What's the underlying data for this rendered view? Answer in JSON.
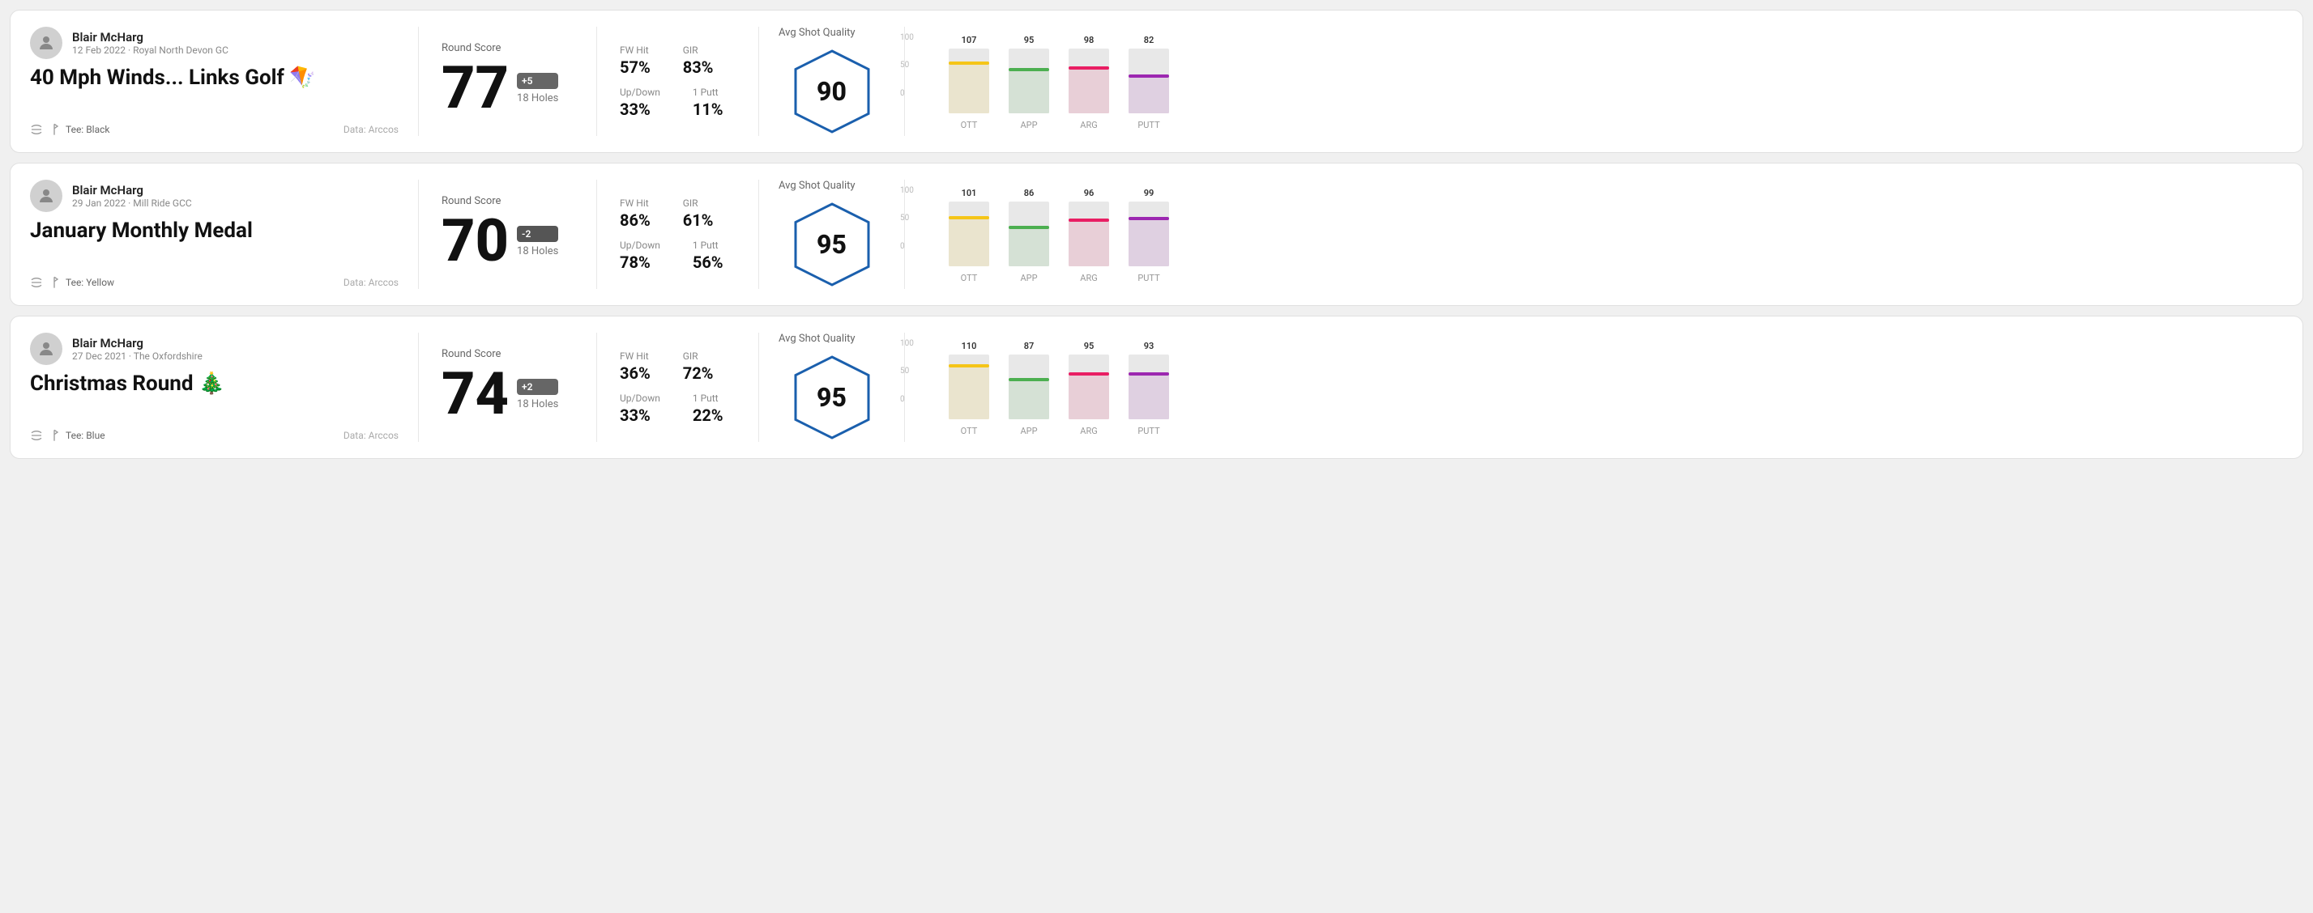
{
  "rounds": [
    {
      "id": "round-1",
      "player": {
        "name": "Blair McHarg",
        "date": "12 Feb 2022",
        "course": "Royal North Devon GC"
      },
      "title": "40 Mph Winds... Links Golf 🪁",
      "tee": "Black",
      "data_source": "Data: Arccos",
      "round_score_label": "Round Score",
      "score": "77",
      "score_diff": "+5",
      "holes": "18 Holes",
      "fw_hit_label": "FW Hit",
      "fw_hit": "57%",
      "gir_label": "GIR",
      "gir": "83%",
      "updown_label": "Up/Down",
      "updown": "33%",
      "oneputt_label": "1 Putt",
      "oneputt": "11%",
      "avg_shot_quality_label": "Avg Shot Quality",
      "quality_score": "90",
      "chart": {
        "bars": [
          {
            "label": "OTT",
            "value": 107,
            "color": "#f5c518",
            "pct": 80
          },
          {
            "label": "APP",
            "value": 95,
            "color": "#4caf50",
            "pct": 70
          },
          {
            "label": "ARG",
            "value": 98,
            "color": "#e91e63",
            "pct": 73
          },
          {
            "label": "PUTT",
            "value": 82,
            "color": "#9c27b0",
            "pct": 60
          }
        ],
        "y_labels": [
          "100",
          "50",
          "0"
        ]
      }
    },
    {
      "id": "round-2",
      "player": {
        "name": "Blair McHarg",
        "date": "29 Jan 2022",
        "course": "Mill Ride GCC"
      },
      "title": "January Monthly Medal",
      "tee": "Yellow",
      "data_source": "Data: Arccos",
      "round_score_label": "Round Score",
      "score": "70",
      "score_diff": "-2",
      "holes": "18 Holes",
      "fw_hit_label": "FW Hit",
      "fw_hit": "86%",
      "gir_label": "GIR",
      "gir": "61%",
      "updown_label": "Up/Down",
      "updown": "78%",
      "oneputt_label": "1 Putt",
      "oneputt": "56%",
      "avg_shot_quality_label": "Avg Shot Quality",
      "quality_score": "95",
      "chart": {
        "bars": [
          {
            "label": "OTT",
            "value": 101,
            "color": "#f5c518",
            "pct": 78
          },
          {
            "label": "APP",
            "value": 86,
            "color": "#4caf50",
            "pct": 63
          },
          {
            "label": "ARG",
            "value": 96,
            "color": "#e91e63",
            "pct": 74
          },
          {
            "label": "PUTT",
            "value": 99,
            "color": "#9c27b0",
            "pct": 76
          }
        ],
        "y_labels": [
          "100",
          "50",
          "0"
        ]
      }
    },
    {
      "id": "round-3",
      "player": {
        "name": "Blair McHarg",
        "date": "27 Dec 2021",
        "course": "The Oxfordshire"
      },
      "title": "Christmas Round 🎄",
      "tee": "Blue",
      "data_source": "Data: Arccos",
      "round_score_label": "Round Score",
      "score": "74",
      "score_diff": "+2",
      "holes": "18 Holes",
      "fw_hit_label": "FW Hit",
      "fw_hit": "36%",
      "gir_label": "GIR",
      "gir": "72%",
      "updown_label": "Up/Down",
      "updown": "33%",
      "oneputt_label": "1 Putt",
      "oneputt": "22%",
      "avg_shot_quality_label": "Avg Shot Quality",
      "quality_score": "95",
      "chart": {
        "bars": [
          {
            "label": "OTT",
            "value": 110,
            "color": "#f5c518",
            "pct": 85
          },
          {
            "label": "APP",
            "value": 87,
            "color": "#4caf50",
            "pct": 64
          },
          {
            "label": "ARG",
            "value": 95,
            "color": "#e91e63",
            "pct": 73
          },
          {
            "label": "PUTT",
            "value": 93,
            "color": "#9c27b0",
            "pct": 72
          }
        ],
        "y_labels": [
          "100",
          "50",
          "0"
        ]
      }
    }
  ]
}
